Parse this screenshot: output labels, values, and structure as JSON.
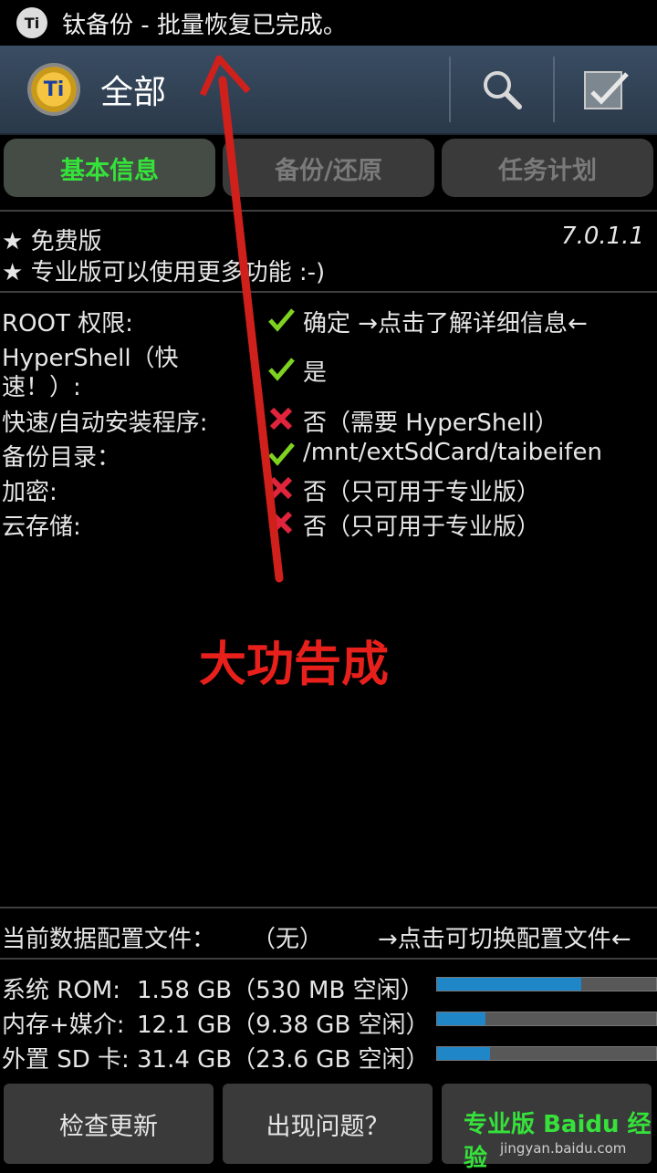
{
  "status_bar": {
    "icon": "Ti",
    "text": "钛备份 - 批量恢复已完成。"
  },
  "action_bar": {
    "logo": "Ti",
    "title": "全部",
    "icons": [
      "search-icon",
      "select-all-icon"
    ]
  },
  "tabs": [
    {
      "label": "基本信息",
      "active": true
    },
    {
      "label": "备份/还原",
      "active": false
    },
    {
      "label": "任务计划",
      "active": false
    }
  ],
  "license": {
    "line1": "★ 免费版",
    "line2": "★ 专业版可以使用更多功能 :-)",
    "version": "7.0.1.1"
  },
  "info_rows": [
    {
      "label": "ROOT 权限:",
      "status": "check",
      "value": "确定 →点击了解详细信息←"
    },
    {
      "label_line1": "HyperShell（快",
      "label_line2": "速！）:",
      "status": "check",
      "value": "是"
    },
    {
      "label": "快速/自动安装程序:",
      "status": "cross",
      "value": "否（需要 HyperShell）"
    },
    {
      "label": "备份目录：",
      "status": "check",
      "value": "/mnt/extSdCard/taibeifen"
    },
    {
      "label": "加密:",
      "status": "cross",
      "value": "否（只可用于专业版）"
    },
    {
      "label": "云存储:",
      "status": "cross",
      "value": "否（只可用于专业版）"
    }
  ],
  "annotation": {
    "text": "大功告成",
    "color": "#e8201c"
  },
  "profile": {
    "label": "当前数据配置文件：",
    "value": "（无）",
    "action": "→点击可切换配置文件←"
  },
  "storage": [
    {
      "label": "系统 ROM:",
      "value": "1.58 GB（530 MB 空闲）",
      "used_fraction": 0.66
    },
    {
      "label": "内存+媒介:",
      "value": "12.1 GB（9.38 GB 空闲）",
      "used_fraction": 0.22
    },
    {
      "label": "外置 SD 卡:",
      "value": "31.4 GB（23.6 GB 空闲）",
      "used_fraction": 0.24
    }
  ],
  "buttons": {
    "check_update": "检查更新",
    "problem": "出现问题？",
    "pro": "专业版"
  },
  "watermark": {
    "main": "Baidu 经验",
    "sub": "jingyan.baidu.com"
  },
  "colors": {
    "accent_green": "#35e13a",
    "progress_blue": "#1f86c8",
    "cross_red": "#e0243c",
    "check_green": "#7ed321"
  }
}
